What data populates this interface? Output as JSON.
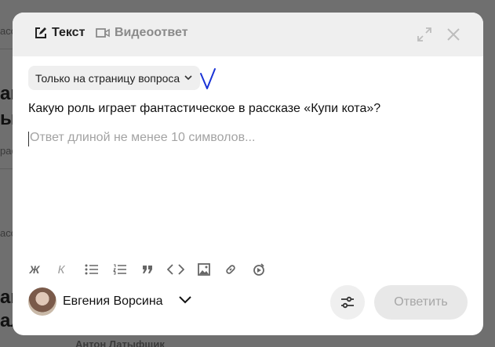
{
  "background": {
    "fragments_top": "асс",
    "fragments_mid": "рас",
    "fragment_heading_1": "ай",
    "fragment_heading_2": "ы.",
    "fragment_heading_3": "ак",
    "fragment_heading_4": "ал",
    "fragment_lower": "асс",
    "bottom_user": "Антон Латыфщик"
  },
  "header": {
    "tab_text_label": "Текст",
    "tab_video_label": "Видеоответ"
  },
  "visibility": {
    "selected": "Только на страницу вопроса"
  },
  "question": {
    "text": "Какую роль играет фантастическое в рассказе «Купи кота»?"
  },
  "answer": {
    "placeholder": "Ответ длиной не менее 10 символов..."
  },
  "toolbar": {
    "bold_label": "Ж",
    "italic_label": "К"
  },
  "author": {
    "name": "Евгения Ворсина"
  },
  "actions": {
    "submit_label": "Ответить"
  },
  "colors": {
    "overlay": "#6f6f6f",
    "header_bg": "#efefef",
    "disabled_button": "#e8e8e8",
    "handwritten_mark": "#1a33d6"
  }
}
